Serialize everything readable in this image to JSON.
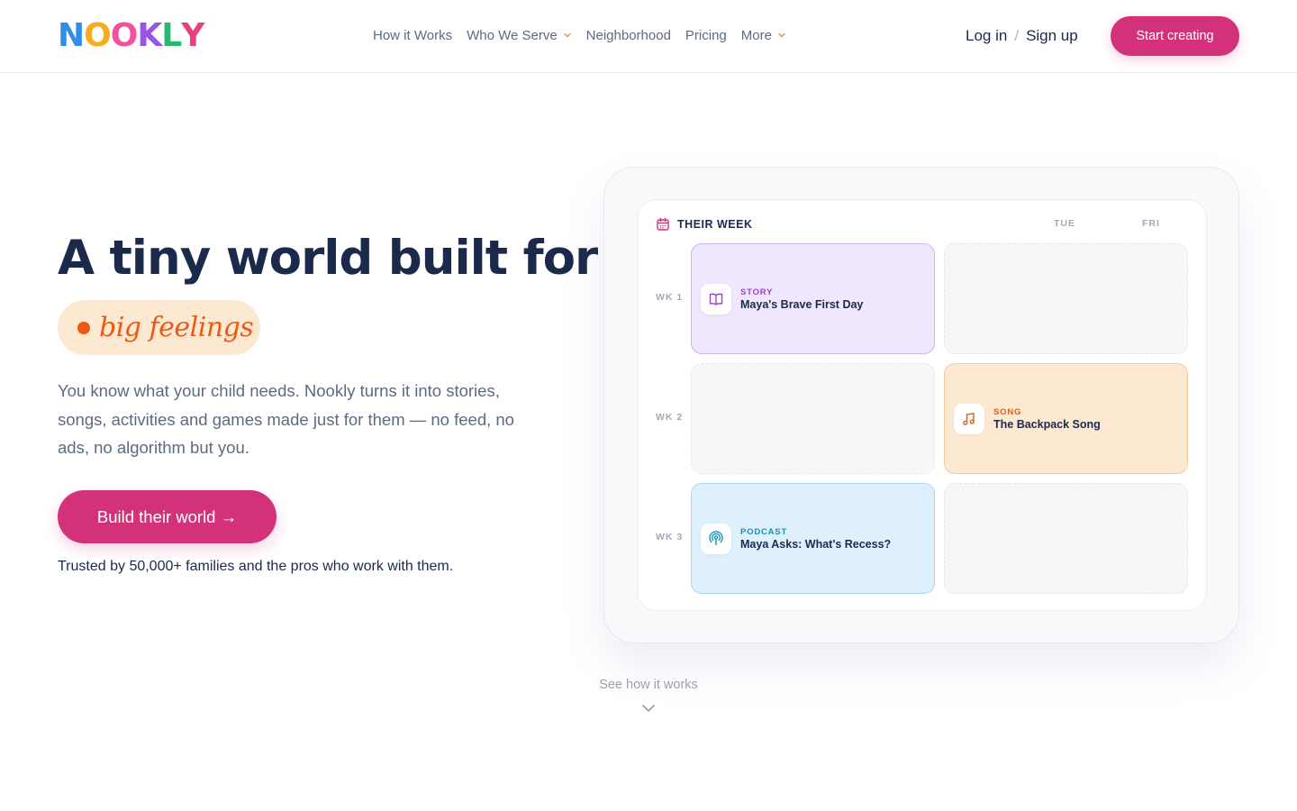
{
  "brand": {
    "letters": [
      {
        "char": "N",
        "color": "#2f8ee8"
      },
      {
        "char": "O",
        "color": "#f7ad1b"
      },
      {
        "char": "O",
        "color": "#f0529c"
      },
      {
        "char": "K",
        "color": "#9a54e4"
      },
      {
        "char": "L",
        "color": "#28b86e"
      },
      {
        "char": "Y",
        "color": "#ec3f7e"
      }
    ]
  },
  "nav": {
    "items": [
      {
        "label": "How it Works",
        "has_dropdown": false
      },
      {
        "label": "Who We Serve",
        "has_dropdown": true
      },
      {
        "label": "Neighborhood",
        "has_dropdown": false
      },
      {
        "label": "Pricing",
        "has_dropdown": false
      },
      {
        "label": "More",
        "has_dropdown": true
      }
    ],
    "login": "Log in",
    "separator": "/",
    "signup": "Sign up",
    "start_button": "Start creating"
  },
  "hero": {
    "title": "A tiny world built for",
    "highlight": "big feelings",
    "description": "You know what your child needs. Nookly turns it into stories, songs, activities and games made just for them — no feed, no ads, no algorithm but you.",
    "cta": "Build their world →",
    "trust": "Trusted by 50,000+ families and the pros who work with them."
  },
  "mockup": {
    "header": "THEIR WEEK",
    "days": [
      "TUE",
      "FRI"
    ],
    "weeks": [
      "WK 1",
      "WK 2",
      "WK 3"
    ],
    "cards": [
      {
        "type": "STORY",
        "title": "Maya's Brave First Day",
        "icon": "book-icon",
        "color": "#a43fc5"
      },
      {
        "type": "SONG",
        "title": "The Backpack Song",
        "icon": "music-note-icon",
        "color": "#e25d12"
      },
      {
        "type": "PODCAST",
        "title": "Maya Asks: What's Recess?",
        "icon": "podcast-icon",
        "color": "#1891b8"
      }
    ]
  },
  "scroll_hint": "See how it works",
  "colors": {
    "primary": "#d3327a",
    "navy": "#1b2a4a",
    "muted": "#5d6b82",
    "accent_orange": "#ea5a12"
  }
}
